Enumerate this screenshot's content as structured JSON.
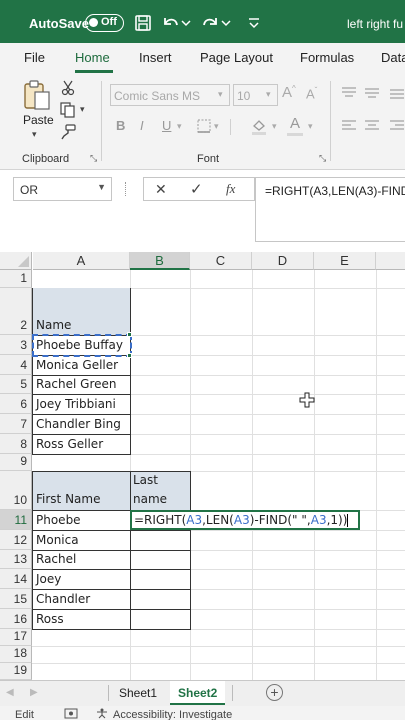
{
  "titlebar": {
    "autosave_label": "AutoSave",
    "autosave_state": "Off",
    "document_title": "left right fu",
    "icons": [
      "save-icon",
      "undo-icon",
      "undo-dropdown-icon",
      "redo-icon",
      "redo-dropdown-icon"
    ]
  },
  "ribbon_tabs": [
    "File",
    "Home",
    "Insert",
    "Page Layout",
    "Formulas",
    "Data"
  ],
  "ribbon_tabs_active": "Home",
  "ribbon": {
    "paste_label": "Paste",
    "clipboard_label": "Clipboard",
    "font_label": "Font",
    "font_name": "Comic Sans MS",
    "font_size": "10",
    "bold": "B",
    "italic": "I",
    "underline": "U"
  },
  "formula_bar": {
    "name_box": "OR",
    "cancel_icon": "✕",
    "enter_icon": "✓",
    "fx_icon": "fx",
    "formula": "=RIGHT(A3,LEN(A3)-FIND(\" \",A3,1))"
  },
  "columns": [
    "A",
    "B",
    "C",
    "D",
    "E"
  ],
  "rows": [
    "1",
    "2",
    "3",
    "4",
    "5",
    "6",
    "7",
    "8",
    "9",
    "10",
    "11",
    "12",
    "13",
    "14",
    "15",
    "16",
    "17",
    "18",
    "19"
  ],
  "cells": {
    "A2": "Name",
    "A3": "Phoebe Buffay",
    "A4": "Monica Geller",
    "A5": "Rachel Green",
    "A6": "Joey Tribbiani",
    "A7": "Chandler Bing",
    "A8": "Ross Geller",
    "A10": "First Name",
    "B10_line1": "Last",
    "B10_line2": "name",
    "A11": "Phoebe",
    "A12": "Monica",
    "A13": "Rachel",
    "A14": "Joey",
    "A15": "Chandler",
    "A16": "Ross"
  },
  "active_cell": "B11",
  "editing_formula_parts": [
    "=RIGHT(",
    "A3",
    ",LEN(",
    "A3",
    ")-FIND(\" \",",
    "A3",
    ",1))"
  ],
  "colors": {
    "excel_green": "#217346",
    "header_shade": "#d9e1ea",
    "reference_blue": "#3a6ec9"
  },
  "sheet_tabs": [
    "Sheet1",
    "Sheet2"
  ],
  "sheet_tabs_active": "Sheet2",
  "add_sheet_icon": "+",
  "status": {
    "mode": "Edit",
    "accessibility": "Accessibility: Investigate"
  }
}
